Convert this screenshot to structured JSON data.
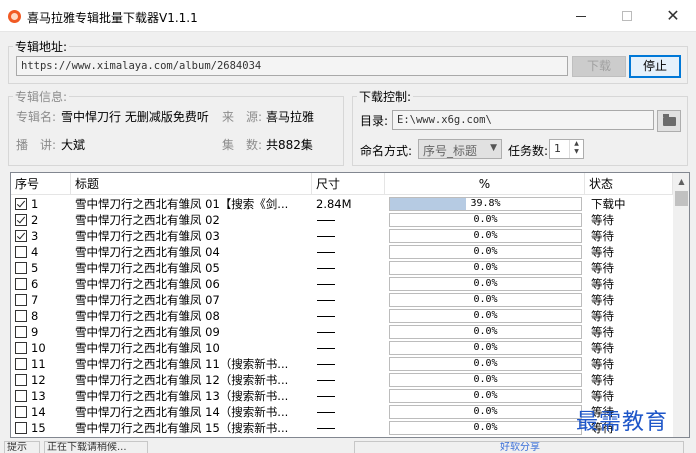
{
  "window": {
    "title": "喜马拉雅专辑批量下载器V1.1.1",
    "minimize_label": "—",
    "maximize_label": "☐",
    "close_label": "✕"
  },
  "album_url": {
    "legend": "专辑地址:",
    "value": "https://www.ximalaya.com/album/2684034",
    "download_label": "下载",
    "stop_label": "停止"
  },
  "album_info": {
    "legend": "专辑信息:",
    "name_label": "专辑名:",
    "name_value": "雪中悍刀行 无删减版免费听",
    "source_label": "来　源:",
    "source_value": "喜马拉雅",
    "narrator_label": "播　讲:",
    "narrator_value": "大斌",
    "episodes_label": "集　数:",
    "episodes_value": "共882集"
  },
  "download_control": {
    "legend": "下载控制:",
    "dir_label": "目录:",
    "dir_value": "E:\\www.x6g.com\\",
    "naming_label": "命名方式:",
    "naming_value": "序号_标题",
    "tasks_label": "任务数:",
    "tasks_value": "1"
  },
  "list": {
    "headers": {
      "seq": "序号",
      "title": "标题",
      "size": "尺寸",
      "percent": "%",
      "status": "状态"
    },
    "rows": [
      {
        "seq": "1",
        "checked": true,
        "title": "雪中悍刀行之西北有雏凤 01【搜索《剑...",
        "size": "2.84M",
        "progress": 0.398,
        "percent": "39.8%",
        "status": "下载中"
      },
      {
        "seq": "2",
        "checked": true,
        "title": "雪中悍刀行之西北有雏凤 02",
        "size": "",
        "progress": 0,
        "percent": "0.0%",
        "status": "等待"
      },
      {
        "seq": "3",
        "checked": true,
        "title": "雪中悍刀行之西北有雏凤 03",
        "size": "",
        "progress": 0,
        "percent": "0.0%",
        "status": "等待"
      },
      {
        "seq": "4",
        "checked": false,
        "title": "雪中悍刀行之西北有雏凤 04",
        "size": "",
        "progress": 0,
        "percent": "0.0%",
        "status": "等待"
      },
      {
        "seq": "5",
        "checked": false,
        "title": "雪中悍刀行之西北有雏凤 05",
        "size": "",
        "progress": 0,
        "percent": "0.0%",
        "status": "等待"
      },
      {
        "seq": "6",
        "checked": false,
        "title": "雪中悍刀行之西北有雏凤 06",
        "size": "",
        "progress": 0,
        "percent": "0.0%",
        "status": "等待"
      },
      {
        "seq": "7",
        "checked": false,
        "title": "雪中悍刀行之西北有雏凤 07",
        "size": "",
        "progress": 0,
        "percent": "0.0%",
        "status": "等待"
      },
      {
        "seq": "8",
        "checked": false,
        "title": "雪中悍刀行之西北有雏凤 08",
        "size": "",
        "progress": 0,
        "percent": "0.0%",
        "status": "等待"
      },
      {
        "seq": "9",
        "checked": false,
        "title": "雪中悍刀行之西北有雏凤 09",
        "size": "",
        "progress": 0,
        "percent": "0.0%",
        "status": "等待"
      },
      {
        "seq": "10",
        "checked": false,
        "title": "雪中悍刀行之西北有雏凤 10",
        "size": "",
        "progress": 0,
        "percent": "0.0%",
        "status": "等待"
      },
      {
        "seq": "11",
        "checked": false,
        "title": "雪中悍刀行之西北有雏凤 11（搜索新书...",
        "size": "",
        "progress": 0,
        "percent": "0.0%",
        "status": "等待"
      },
      {
        "seq": "12",
        "checked": false,
        "title": "雪中悍刀行之西北有雏凤 12（搜索新书...",
        "size": "",
        "progress": 0,
        "percent": "0.0%",
        "status": "等待"
      },
      {
        "seq": "13",
        "checked": false,
        "title": "雪中悍刀行之西北有雏凤 13（搜索新书...",
        "size": "",
        "progress": 0,
        "percent": "0.0%",
        "status": "等待"
      },
      {
        "seq": "14",
        "checked": false,
        "title": "雪中悍刀行之西北有雏凤 14（搜索新书...",
        "size": "",
        "progress": 0,
        "percent": "0.0%",
        "status": "等待"
      },
      {
        "seq": "15",
        "checked": false,
        "title": "雪中悍刀行之西北有雏凤 15（搜索新书...",
        "size": "",
        "progress": 0,
        "percent": "0.0%",
        "status": "等待"
      }
    ]
  },
  "statusbar": {
    "part1": "提示",
    "part2": "正在下载请稍候...",
    "part3": "好软分享"
  },
  "watermark": "最需教育",
  "colors": {
    "progress_fill": "#b6cbe3",
    "default_button_border": "#0078d7",
    "watermark": "#1e56c8",
    "app_icon": "#f15a24"
  }
}
